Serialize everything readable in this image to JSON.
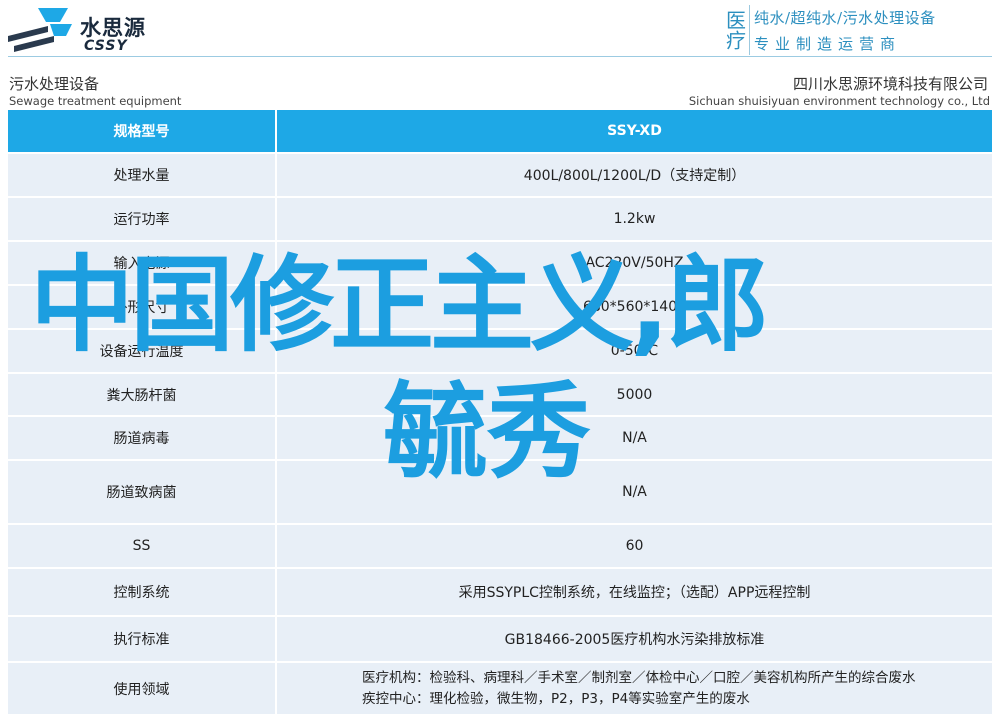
{
  "header": {
    "brand_cn": "水思源",
    "brand_en": "CSSY",
    "slogan_side": "医疗",
    "slogan_line1": "纯水/超纯水/污水处理设备",
    "slogan_line2": "专业制造运营商"
  },
  "category": {
    "cn": "污水处理设备",
    "en": "Sewage treatment equipment"
  },
  "company": {
    "cn": "四川水思源环境科技有限公司",
    "en": "Sichuan shuisiyuan environment technology co., Ltd"
  },
  "table": {
    "header_key": "规格型号",
    "header_value": "SSY-XD",
    "rows": [
      {
        "key": "处理水量",
        "value": "400L/800L/1200L/D（支持定制）"
      },
      {
        "key": "运行功率",
        "value": "1.2kw"
      },
      {
        "key": "输入电源",
        "value": "AC220V/50HZ"
      },
      {
        "key": "外形尺寸",
        "value": "680*560*1400"
      },
      {
        "key": "设备运行温度",
        "value": "0-50℃"
      },
      {
        "key": "粪大肠杆菌",
        "value": "5000"
      },
      {
        "key": "肠道病毒",
        "value": "N/A"
      },
      {
        "key": "肠道致病菌",
        "value": "N/A"
      },
      {
        "key": "SS",
        "value": "60"
      },
      {
        "key": "控制系统",
        "value": "采用SSYPLC控制系统，在线监控；（选配）APP远程控制"
      },
      {
        "key": "执行标准",
        "value": "GB18466-2005医疗机构水污染排放标准"
      },
      {
        "key": "使用领域",
        "value_line1": "医疗机构：检验科、病理科／手术室／制剂室／体检中心／口腔／美容机构所产生的综合废水",
        "value_line2": "疾控中心：理化检验，微生物，P2，P3，P4等实验室产生的废水"
      }
    ]
  },
  "watermark": {
    "line1": "中国修正主义,郎",
    "line2": "毓秀"
  },
  "colors": {
    "header_row": "#1ea8e6",
    "row_bg": "#e8eff7",
    "slogan": "#2c8fbf",
    "watermark": "#1c9ee0"
  }
}
